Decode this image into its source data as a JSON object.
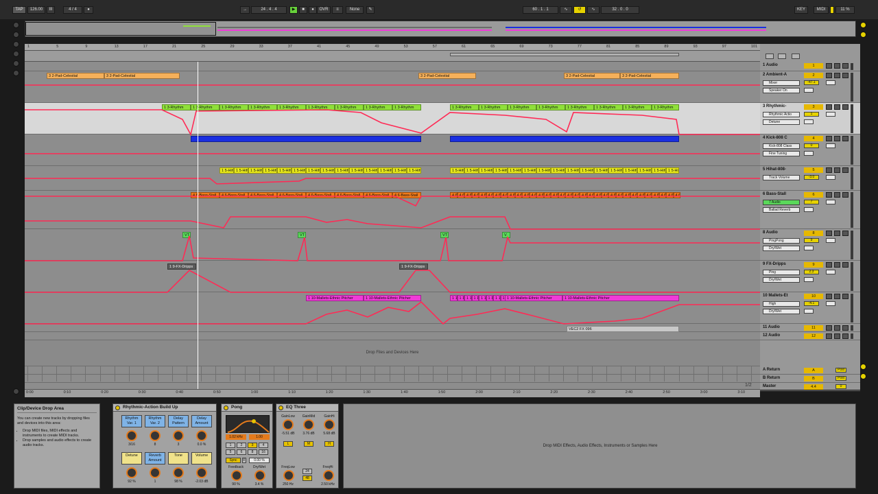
{
  "transport": {
    "tap": "TAP",
    "tempo": "126.00",
    "tempo_nudge": "III",
    "signature": "4 / 4",
    "metronome": "●",
    "position": "24 . 4 . 4",
    "ovr": "OVR",
    "quantize": "None",
    "loop_start": "60 . 1 . 1",
    "loop_length": "32 . 0 . 0",
    "key": "KEY",
    "midi": "MIDI",
    "cpu": "11 %"
  },
  "rulers": {
    "bars": [
      "1",
      "5",
      "9",
      "13",
      "17",
      "21",
      "25",
      "29",
      "33",
      "37",
      "41",
      "45",
      "49",
      "53",
      "57",
      "61",
      "65",
      "69",
      "73",
      "77",
      "81",
      "85",
      "89",
      "93",
      "97",
      "101"
    ],
    "times": [
      "0:00",
      "0:10",
      "0:20",
      "0:30",
      "0:40",
      "0:50",
      "1:00",
      "1:10",
      "1:20",
      "1:30",
      "1:40",
      "1:50",
      "2:00",
      "2:10",
      "2:20",
      "2:30",
      "2:40",
      "2:50",
      "3:00",
      "3:10"
    ],
    "page": "1/2"
  },
  "clips": {
    "pad": "3 2-Pad-Celestial",
    "rhythm": "1 3-Rhythm",
    "hihat": "1 5-Hihat",
    "bass": "4 6-Bass-Stall",
    "fx_drip": "1 9-FX-Dripps",
    "mallets": "1 10-Mallets-Ethnic Pitcher",
    "vec": "VEC2 FX 096",
    "marker_v": "V",
    "marker_vt": "VT"
  },
  "drop_files_text": "Drop Files and Devices Here",
  "tracks": [
    {
      "name": "1 Audio",
      "num": "1",
      "sel1": "",
      "sel2": "",
      "val": ""
    },
    {
      "name": "2 Ambient-A",
      "num": "2",
      "sel1": "Mixer",
      "sel2": "Speaker On",
      "val": "-47.1"
    },
    {
      "name": "3 Rhythmic-",
      "num": "3",
      "sel1": "Rhythmic Actio",
      "sel2": "Detune",
      "val": "1"
    },
    {
      "name": "4 Kick-808 C",
      "num": "4",
      "sel1": "Kick-808 Class",
      "sel2": "Fine Tuning",
      "val": "0"
    },
    {
      "name": "5 Hihat-808-",
      "num": "5",
      "sel1": "Track Volume",
      "sel2": "",
      "val": "-3.0"
    },
    {
      "name": "6 Bass-Stall",
      "num": "6",
      "sel1": "7 Audio",
      "sel2": "Ballad Reverb",
      "val": "7"
    },
    {
      "name": "8 Audio",
      "num": "8",
      "sel1": "PingPong",
      "sel2": "Dry/Wet",
      "val": "9"
    },
    {
      "name": "9 FX-Dripps",
      "num": "9",
      "sel1": "Ping",
      "sel2": "Dry/Wet",
      "val": "2.3"
    },
    {
      "name": "10 Mallets-Et",
      "num": "10",
      "sel1": "High",
      "sel2": "Dry/Wet",
      "val": "-4.1"
    },
    {
      "name": "11 Audio",
      "num": "11",
      "sel1": "",
      "sel2": "",
      "val": ""
    },
    {
      "name": "12 Audio",
      "num": "12",
      "sel1": "",
      "sel2": "",
      "val": ""
    }
  ],
  "returns": [
    {
      "name": "A Return",
      "num": "A",
      "post": "Post"
    },
    {
      "name": "B Return",
      "num": "B",
      "post": "Post"
    },
    {
      "name": "Master",
      "num": "4.4",
      "post": "0"
    }
  ],
  "info": {
    "title": "Clip/Device Drop Area",
    "body": "You can create new tracks by dropping files and devices into this area:",
    "bullets": [
      "Drop MIDI files, MIDI effects and instruments to create MIDI tracks.",
      "Drop samples and audio effects to create audio tracks."
    ]
  },
  "rack": {
    "title": "Rhythmic-Action Build Up",
    "macros": [
      {
        "label": "Rhythm Var. 1",
        "value": "3/16"
      },
      {
        "label": "Rhythm Var. 2",
        "value": "8"
      },
      {
        "label": "Delay Pattern",
        "value": "3"
      },
      {
        "label": "Delay Amount",
        "value": "0.0 %"
      },
      {
        "label": "Detune",
        "value": "92 %"
      },
      {
        "label": "Reverb Amount",
        "value": "1"
      },
      {
        "label": "Tone",
        "value": "98 %"
      },
      {
        "label": "Volume",
        "value": "-2.03 dB"
      }
    ]
  },
  "pong": {
    "title": "Pong",
    "freq": "1.02 kHz",
    "width": "1.00",
    "sync": "Sync",
    "f_label": "F",
    "time_val": "0.00 %",
    "feedback_label": "Feedback",
    "feedback": "90 %",
    "drywet_label": "Dry/Wet",
    "drywet": "3.4 %",
    "steps": [
      "1",
      "2",
      "3",
      "4",
      "5",
      "6",
      "8",
      "16"
    ]
  },
  "eq": {
    "title": "EQ Three",
    "gains": [
      {
        "label": "GainLow",
        "value": "-5.51 dB",
        "band": "L"
      },
      {
        "label": "GainMid",
        "value": "3.76 dB",
        "band": "M"
      },
      {
        "label": "GainHi",
        "value": "5.68 dB",
        "band": "H"
      }
    ],
    "freqlow_label": "FreqLow",
    "freqlow": "250 Hz",
    "freqhi_label": "FreqHi",
    "freqhi": "2.50 kHz",
    "slope": "24",
    "slope2": "48"
  },
  "drop_fx_text": "Drop MIDI Effects, Audio Effects, Instruments or Samples Here",
  "colors": {
    "automation": "#ff2a55",
    "pad_clip": "#f5b05a",
    "rhythm_clip": "#8fe03a",
    "kick_clip": "#1a2fe0",
    "hihat_clip": "#e8e81a",
    "bass_clip": "#f07a1a",
    "fx_clip": "#5a5a5a",
    "mallets_clip": "#f03ad8",
    "vec_clip": "#c8c8c8"
  }
}
